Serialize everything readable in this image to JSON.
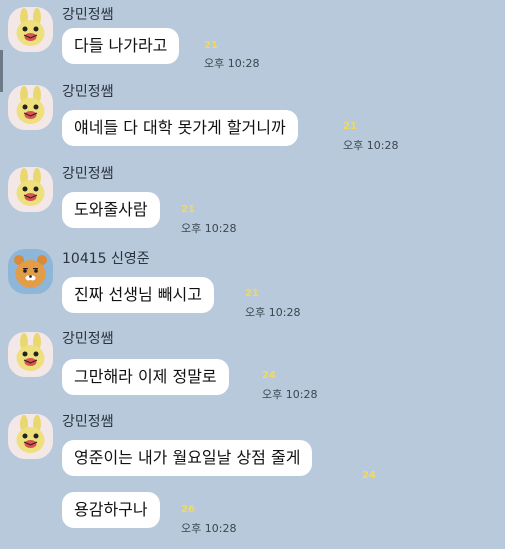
{
  "conversation": {
    "messages": [
      {
        "sender": "강민정쌤",
        "text": "다들 나가라고",
        "unread": "21",
        "time": "오후 10:28",
        "avatar": "kakao-muzi-icon"
      },
      {
        "sender": "강민정쌤",
        "text": "얘네들 다 대학 못가게 할거니까",
        "unread": "21",
        "time": "오후 10:28",
        "avatar": "kakao-muzi-icon"
      },
      {
        "sender": "강민정쌤",
        "text": "도와줄사람",
        "unread": "21",
        "time": "오후 10:28",
        "avatar": "kakao-muzi-icon"
      },
      {
        "sender": "10415 신영준",
        "text": "진짜 선생님 빼시고",
        "unread": "21",
        "time": "오후 10:28",
        "avatar": "kakao-ryan-icon"
      },
      {
        "sender": "강민정쌤",
        "text": "그만해라 이제 정말로",
        "unread": "24",
        "time": "오후 10:28",
        "avatar": "kakao-muzi-icon"
      },
      {
        "sender": "강민정쌤",
        "text": "영준이는 내가 월요일날 상점 줄게",
        "unread": "24",
        "time": "",
        "avatar": "kakao-muzi-icon"
      },
      {
        "sender": "",
        "text": "용감하구나",
        "unread": "26",
        "time": "오후 10:28",
        "avatar": ""
      }
    ]
  },
  "colors": {
    "background": "#b7c9da",
    "bubble": "#ffffff",
    "unread": "#f3d95a"
  }
}
